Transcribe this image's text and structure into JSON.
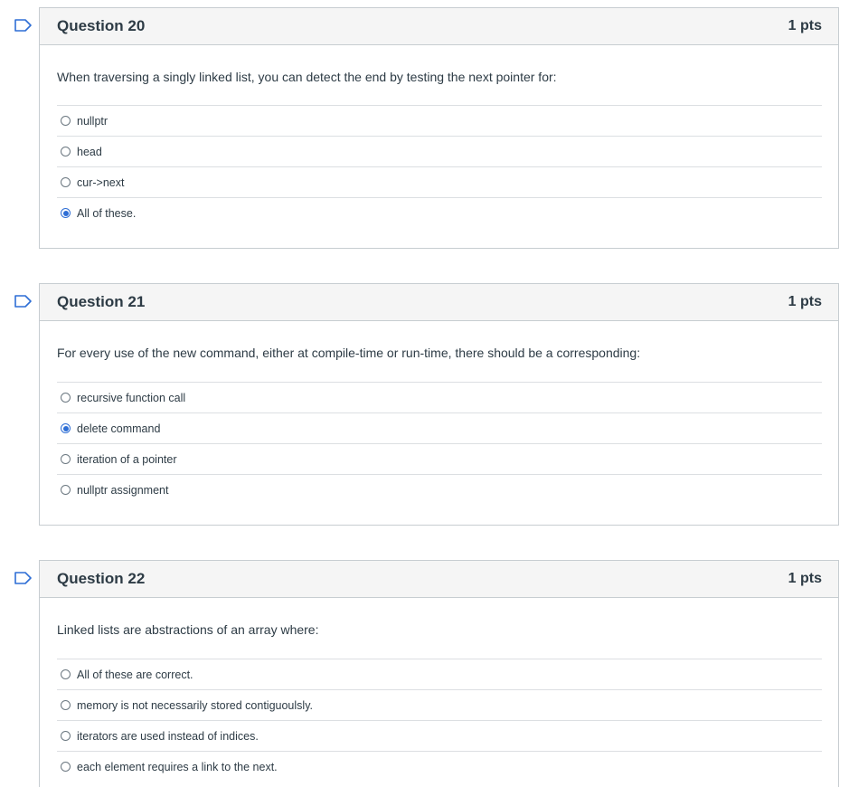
{
  "questions": [
    {
      "title": "Question 20",
      "points": "1 pts",
      "text": "When traversing a singly linked list, you can detect the end by testing the next pointer for:",
      "answers": [
        {
          "label": "nullptr",
          "selected": false
        },
        {
          "label": "head",
          "selected": false
        },
        {
          "label": "cur->next",
          "selected": false
        },
        {
          "label": "All of these.",
          "selected": true
        }
      ]
    },
    {
      "title": "Question 21",
      "points": "1 pts",
      "text": "For every use of the new command, either at compile-time or run-time, there should be a corresponding:",
      "answers": [
        {
          "label": "recursive function call",
          "selected": false
        },
        {
          "label": "delete command",
          "selected": true
        },
        {
          "label": "iteration of a pointer",
          "selected": false
        },
        {
          "label": "nullptr assignment",
          "selected": false
        }
      ]
    },
    {
      "title": "Question 22",
      "points": "1 pts",
      "text": "Linked lists are abstractions of an array where:",
      "answers": [
        {
          "label": "All of these are correct.",
          "selected": false
        },
        {
          "label": "memory is not necessarily stored contiguoulsly.",
          "selected": false
        },
        {
          "label": "iterators are used instead of indices.",
          "selected": false
        },
        {
          "label": "each element requires a link to the next.",
          "selected": false
        }
      ]
    }
  ],
  "colors": {
    "accent": "#2e6ed5",
    "header_bg": "#f5f5f5",
    "border": "#c7cdd1"
  },
  "icons": {
    "flag": "bookmark-flag-icon",
    "radio": "radio-icon"
  }
}
